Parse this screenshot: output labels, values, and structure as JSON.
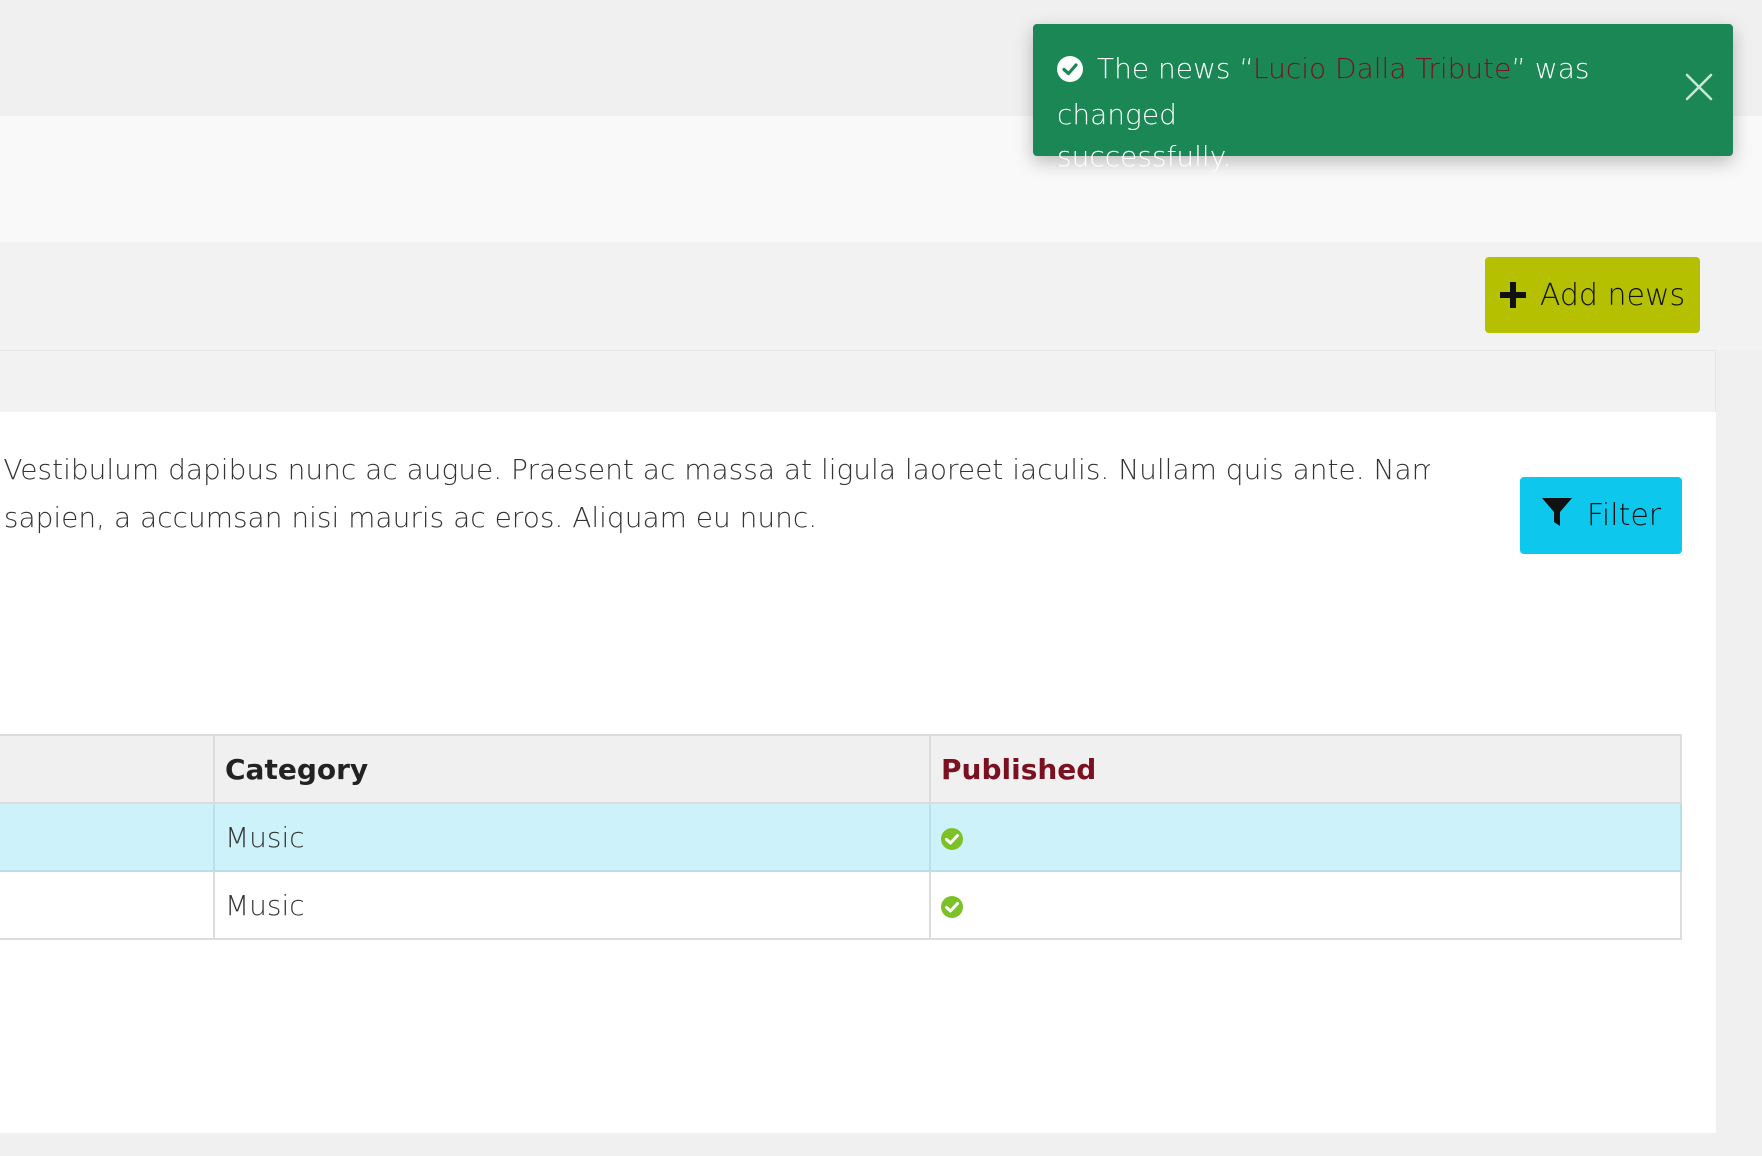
{
  "toast": {
    "prefix": "The news “",
    "news_title": "Lucio Dalla Tribute",
    "suffix": "” was changed",
    "line2": "successfully."
  },
  "toolbar": {
    "add_news_label": "Add news"
  },
  "filter": {
    "label": "Filter",
    "description_line1": "ni. Vestibulum dapibus nunc ac augue. Praesent ac massa at ligula laoreet iaculis. Nullam quis ante. Nam at tortor in tellus",
    "description_line2": "ue sapien, a accumsan nisi mauris ac eros. Aliquam eu nunc."
  },
  "table": {
    "headers": {
      "category": "Category",
      "published": "Published"
    },
    "rows": [
      {
        "category": "Music",
        "published": true
      },
      {
        "category": "Music",
        "published": true
      }
    ]
  },
  "colors": {
    "toast_bg": "#1a8754",
    "add_button": "#b5c100",
    "filter_button": "#0dc8ec",
    "row_highlight": "#cdf2f9",
    "published_header": "#7a1020",
    "check_green": "#7cc226"
  },
  "icons": {
    "toast": "check-circle-icon",
    "close": "close-icon",
    "add": "plus-icon",
    "filter": "filter-icon",
    "published": "check-circle-icon"
  }
}
